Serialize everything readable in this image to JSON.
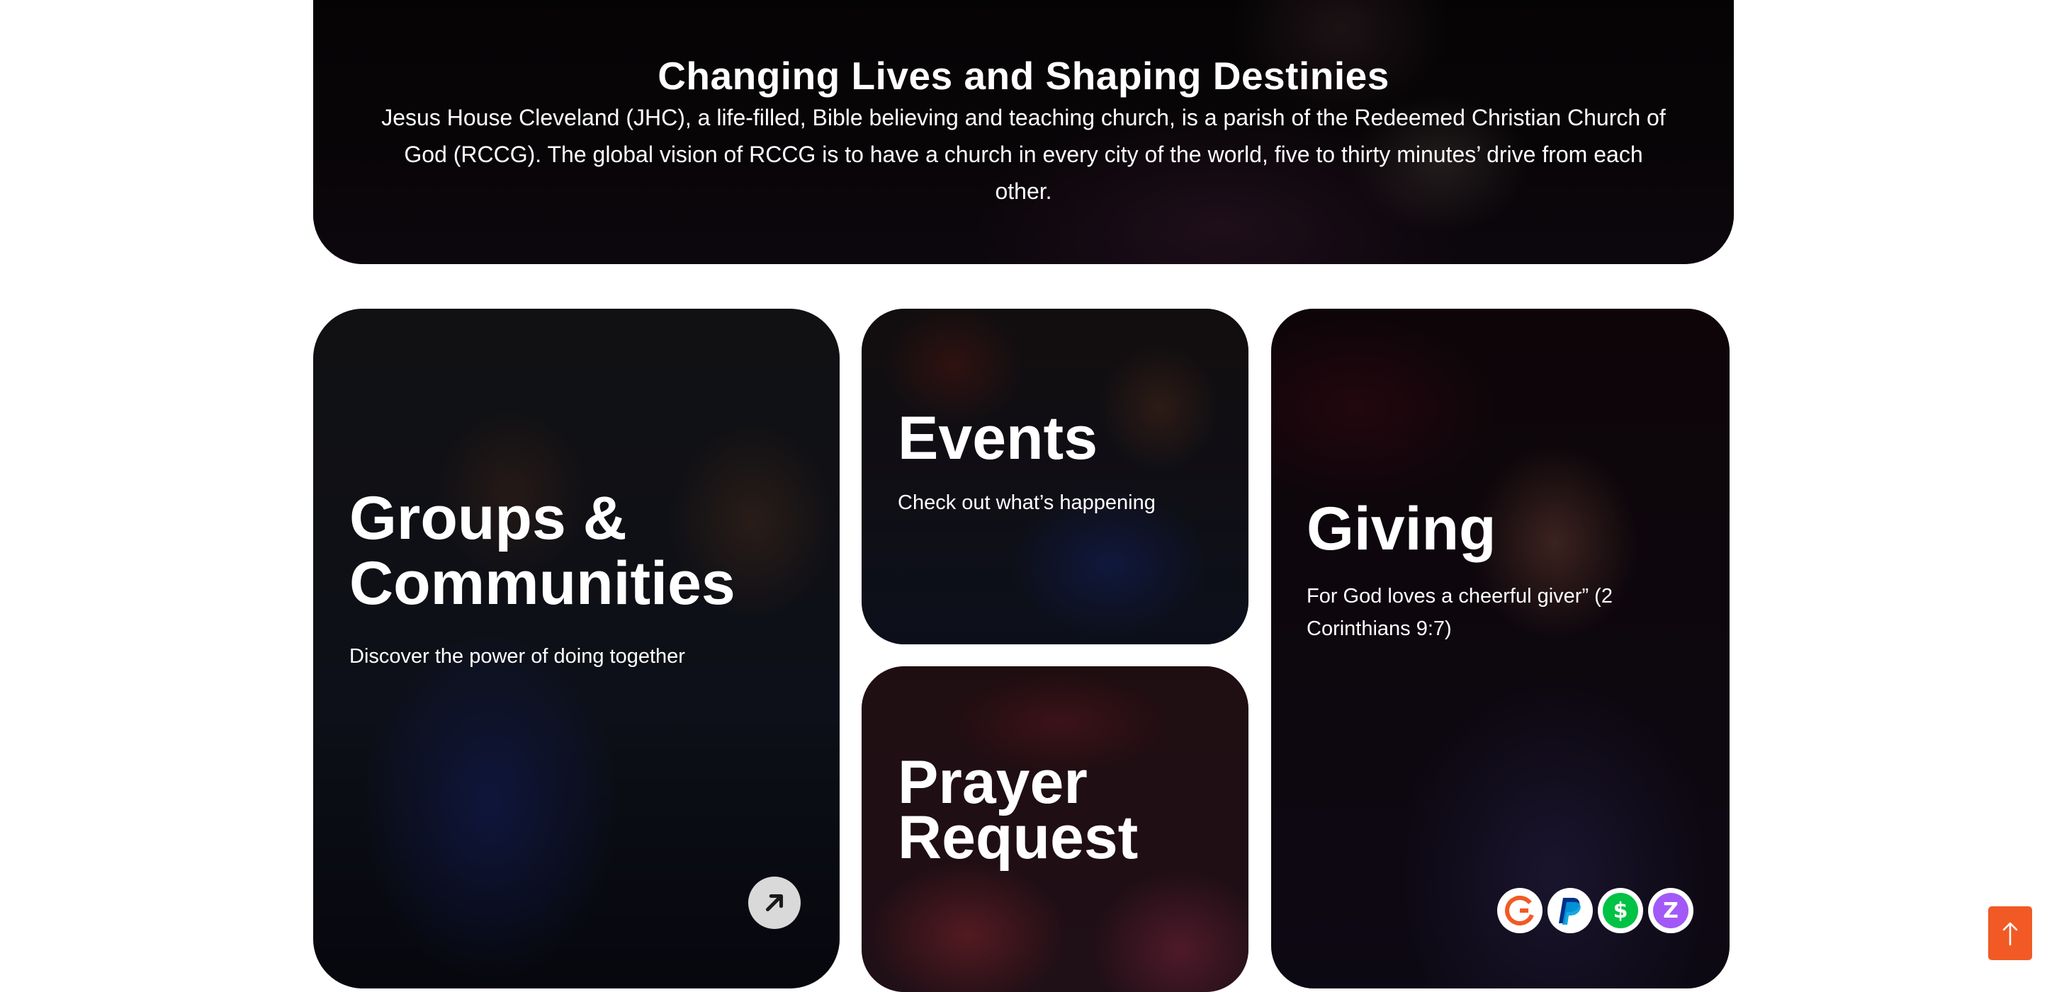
{
  "hero": {
    "title": "Changing Lives and Shaping Destinies",
    "text": "Jesus House Cleveland (JHC), a life-filled, Bible believing and teaching church, is a parish of the Redeemed Christian Church of God (RCCG). The global vision of RCCG is to have a church in every city of the world, five to thirty minutes’ drive from each other."
  },
  "cards": {
    "groups": {
      "title_line1": "Groups &",
      "title_line2": "Communities",
      "subtitle": "Discover the power of doing together"
    },
    "events": {
      "title": "Events",
      "subtitle": "Check out what’s happening"
    },
    "prayer": {
      "title_line1": "Prayer",
      "title_line2": "Request"
    },
    "giving": {
      "title": "Giving",
      "subtitle": "For God loves a cheerful giver” (2 Corinthians 9:7)"
    }
  },
  "giving_methods": [
    {
      "name": "givelify-icon",
      "color": "#f15a24"
    },
    {
      "name": "paypal-icon",
      "color": "#003087"
    },
    {
      "name": "cashapp-icon",
      "color": "#00c244"
    },
    {
      "name": "zelle-icon",
      "color": "#a259f7"
    }
  ],
  "icons": {
    "arrow": "arrow-up-right-icon",
    "scroll_top": "arrow-up-icon"
  },
  "colors": {
    "accent": "#f15a24"
  }
}
